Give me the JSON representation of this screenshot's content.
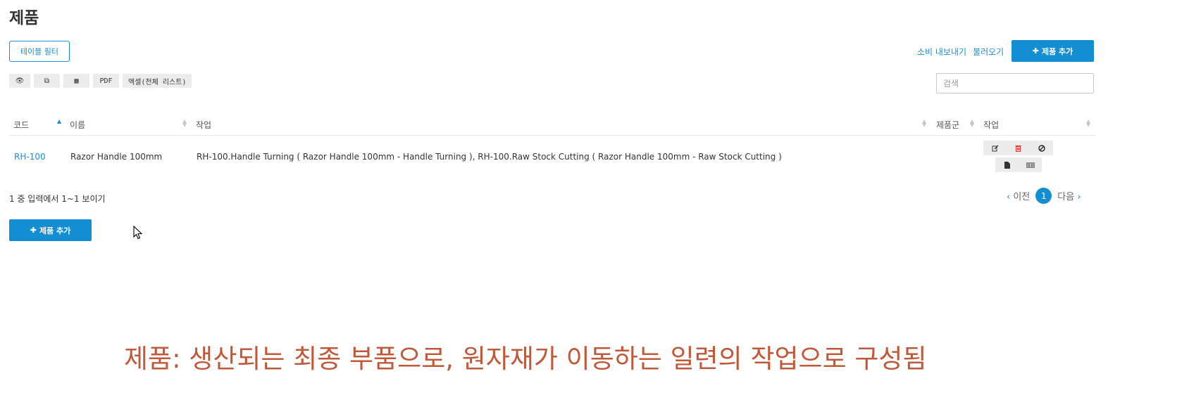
{
  "page": {
    "title": "제품"
  },
  "toolbar": {
    "table_filter_label": "테이블 필터",
    "consumer_export_label": "소비 내보내기",
    "import_label": "불러오기",
    "add_product_label": "제품 추가",
    "export_buttons": [
      "👁",
      "⧉",
      "▦",
      "PDF",
      "엑셀(전체 리스트)"
    ],
    "search_placeholder": "검색"
  },
  "table": {
    "columns": [
      "코드",
      "이름",
      "작업",
      "제품군",
      "작업"
    ],
    "rows": [
      {
        "code": "RH-100",
        "name": "Razor Handle 100mm",
        "operations": "RH-100.Handle Turning ( Razor Handle 100mm - Handle Turning ), RH-100.Raw Stock Cutting ( Razor Handle 100mm - Raw Stock Cutting )",
        "product_group": ""
      }
    ]
  },
  "footer": {
    "summary": "1 중 입력에서 1~1 보이기",
    "prev_label": "이전",
    "current_page": "1",
    "next_label": "다음"
  },
  "caption": "제품: 생산되는 최종 부품으로, 원자재가 이동하는 일련의 작업으로 구성됨",
  "colors": {
    "accent": "#138ed3",
    "caption": "#c2583a"
  }
}
